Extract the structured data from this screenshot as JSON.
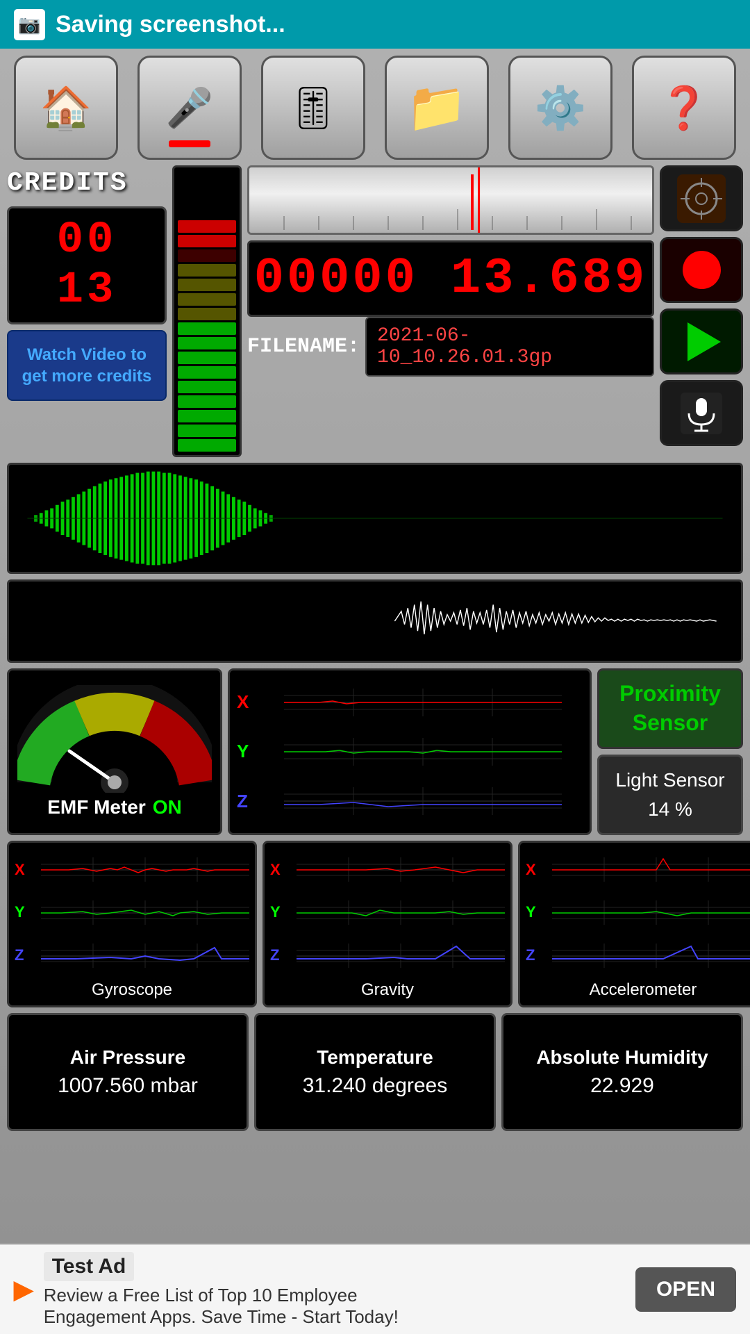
{
  "statusBar": {
    "icon": "📷",
    "text": "Saving screenshot..."
  },
  "toolbar": {
    "buttons": [
      {
        "label": "🏠",
        "name": "home"
      },
      {
        "label": "🎤",
        "name": "microphone",
        "active": true
      },
      {
        "label": "🎚️",
        "name": "mixer"
      },
      {
        "label": "📁",
        "name": "folder"
      },
      {
        "label": "⚙️",
        "name": "settings"
      },
      {
        "label": "❓",
        "name": "help"
      }
    ]
  },
  "credits": {
    "label": "CREDITS",
    "value": "00 13",
    "watchVideoLabel": "Watch Video to\nget more credits"
  },
  "counter": {
    "value": "00000 13.689"
  },
  "filename": {
    "label": "FILENAME:",
    "value": "2021-06-10_10.26.01.3gp"
  },
  "proximitySensor": {
    "label": "Proximity\nSensor"
  },
  "lightSensor": {
    "label": "Light Sensor",
    "value": "14 %"
  },
  "emfMeter": {
    "label": "EMF Meter",
    "status": "ON"
  },
  "sensorCharts": [
    {
      "label": "Gyroscope"
    },
    {
      "label": "Gravity"
    },
    {
      "label": "Accelerometer"
    }
  ],
  "environment": [
    {
      "label": "Air Pressure",
      "value": "1007.560 mbar"
    },
    {
      "label": "Temperature",
      "value": "31.240 degrees"
    },
    {
      "label": "Absolute Humidity",
      "value": "22.929"
    }
  ],
  "ad": {
    "title": "Test Ad",
    "subtitle": "Review a Free List of Top 10 Employee\nEngagement Apps. Save Time - Start Today!",
    "openLabel": "OPEN"
  }
}
